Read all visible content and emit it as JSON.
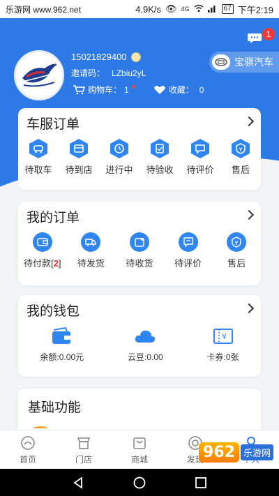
{
  "statusbar": {
    "site": "乐游网 www.962.net",
    "speed": "4.9K/s",
    "signal": "4G",
    "battery": "67",
    "time": "下午2:19"
  },
  "header": {
    "message_badge": "1",
    "phone": "15021829400",
    "invite_label": "邀请码：",
    "invite_code": "LZbiu2yL",
    "cart_label": "购物车：",
    "cart_count": "1",
    "fav_label": "收藏：",
    "fav_count": "0",
    "brand": "宝骐汽车"
  },
  "service_orders": {
    "title": "车服订单",
    "items": [
      {
        "label": "待取车",
        "icon": "car-pickup-icon"
      },
      {
        "label": "待到店",
        "icon": "store-arrival-icon"
      },
      {
        "label": "进行中",
        "icon": "in-progress-icon"
      },
      {
        "label": "待验收",
        "icon": "inspection-icon"
      },
      {
        "label": "待评价",
        "icon": "review-icon"
      },
      {
        "label": "售后",
        "icon": "after-sales-icon"
      }
    ]
  },
  "my_orders": {
    "title": "我的订单",
    "items": [
      {
        "label": "待付款",
        "count": "2",
        "icon": "wallet-icon"
      },
      {
        "label": "待发货",
        "icon": "delivery-truck-icon"
      },
      {
        "label": "待收货",
        "icon": "receive-box-icon"
      },
      {
        "label": "待评价",
        "icon": "review-icon"
      },
      {
        "label": "售后",
        "icon": "after-sales-icon"
      }
    ]
  },
  "wallet": {
    "title": "我的钱包",
    "items": [
      {
        "label": "余额:0.00元",
        "icon": "wallet-icon"
      },
      {
        "label": "云豆:0.00",
        "icon": "cloud-icon"
      },
      {
        "label": "卡券:0张",
        "icon": "coupon-icon"
      }
    ]
  },
  "basic": {
    "title": "基础功能"
  },
  "tabs": [
    {
      "label": "首页",
      "icon": "home-icon"
    },
    {
      "label": "门店",
      "icon": "store-icon"
    },
    {
      "label": "商城",
      "icon": "mall-icon"
    },
    {
      "label": "发现",
      "icon": "discover-icon"
    },
    {
      "label": "个人",
      "icon": "profile-icon",
      "active": true
    }
  ],
  "watermark": {
    "logo": "962",
    "sub": "乐游网"
  },
  "colors": {
    "primary": "#2d7ae6",
    "badge": "#ef3b3b",
    "icon_blue": "#3086f0"
  }
}
